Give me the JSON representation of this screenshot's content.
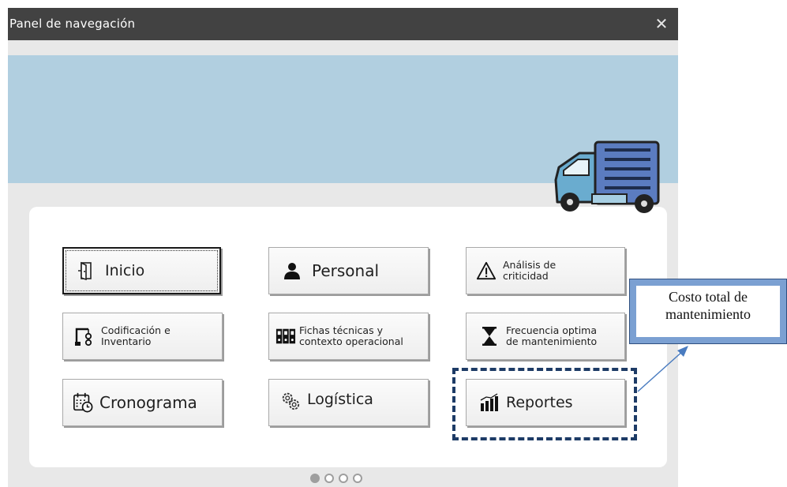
{
  "window": {
    "title": "Panel de navegación",
    "close_symbol": "✕"
  },
  "buttons": [
    {
      "id": "inicio",
      "label": "Inicio",
      "icon": "door-exit-icon",
      "active": true
    },
    {
      "id": "personal",
      "label": "Personal",
      "icon": "person-icon"
    },
    {
      "id": "analisis",
      "label": "Análisis de\ncriticidad",
      "icon": "warning-icon"
    },
    {
      "id": "codificacion",
      "label": "Codificación e\nInventario",
      "icon": "crane-gear-icon"
    },
    {
      "id": "fichas",
      "label": "Fichas técnicas y\ncontexto operacional",
      "icon": "binders-icon"
    },
    {
      "id": "frecuencia",
      "label": "Frecuencia optima\nde mantenimiento",
      "icon": "hourglass-icon"
    },
    {
      "id": "cronograma",
      "label": "Cronograma",
      "icon": "calendar-clock-icon"
    },
    {
      "id": "logistica",
      "label": "Logística",
      "icon": "gears-icon"
    },
    {
      "id": "reportes",
      "label": "Reportes",
      "icon": "bar-chart-icon"
    }
  ],
  "annotation": {
    "callout_text": "Costo total de mantenimiento"
  },
  "pager": {
    "page_count": 4,
    "current_page": 1
  },
  "colors": {
    "titlebar": "#424242",
    "banner": "#b1cfe0",
    "truck_cab": "#6aaccf",
    "truck_cargo": "#5b7cc0",
    "highlight": "#1d3b66",
    "callout_border": "#7ba0d2"
  }
}
